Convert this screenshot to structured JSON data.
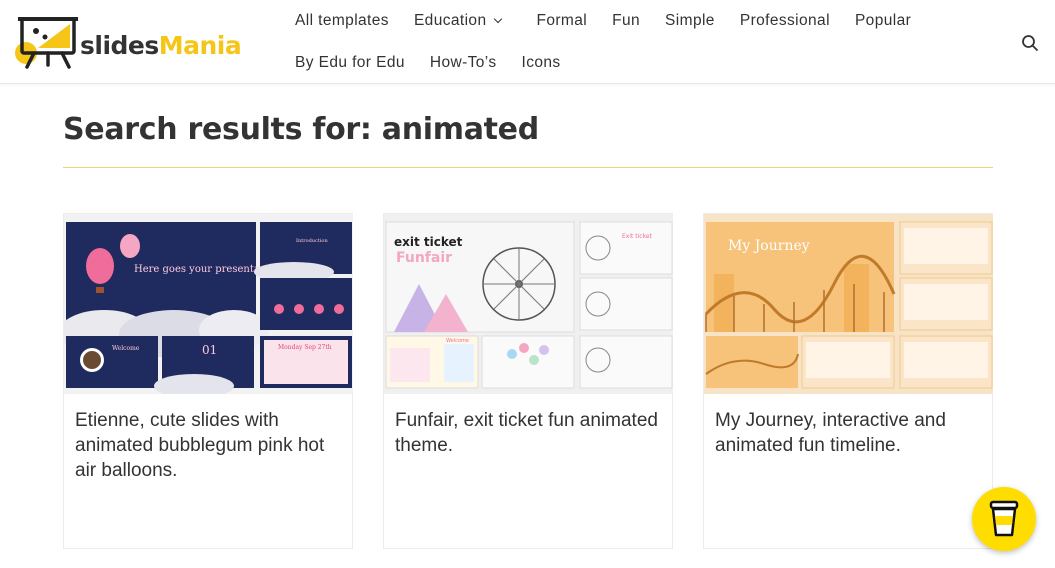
{
  "logo": {
    "part1": "slides",
    "part2": "Mania"
  },
  "nav": {
    "row1": [
      {
        "label": "All templates"
      },
      {
        "label": "Education",
        "dropdown": true
      },
      {
        "label": "Formal"
      },
      {
        "label": "Fun"
      },
      {
        "label": "Simple"
      },
      {
        "label": "Professional"
      },
      {
        "label": "Popular"
      }
    ],
    "row2": [
      {
        "label": "By Edu for Edu"
      },
      {
        "label": "How-To’s"
      },
      {
        "label": "Icons"
      }
    ]
  },
  "page": {
    "title": "Search results for: animated"
  },
  "cards": [
    {
      "caption": "Etienne, cute slides with animated bubblegum pink hot air balloons.",
      "thumb_text": {
        "main": "Here goes your presentation title",
        "s2": "Introduction",
        "s4": "Welcome",
        "s5": "01",
        "s6": "Monday Sep 27th"
      }
    },
    {
      "caption": "Funfair, exit ticket fun animated theme.",
      "thumb_text": {
        "line1": "exit ticket",
        "line2": "Funfair",
        "s2": "Exit ticket",
        "s5": "Welcome"
      }
    },
    {
      "caption": "My Journey, interactive and animated fun timeline.",
      "thumb_text": {
        "main": "My Journey"
      }
    }
  ],
  "colors": {
    "brand_yellow": "#f5c518",
    "coffee_yellow": "#ffdd00",
    "rule": "#e8d77a"
  }
}
